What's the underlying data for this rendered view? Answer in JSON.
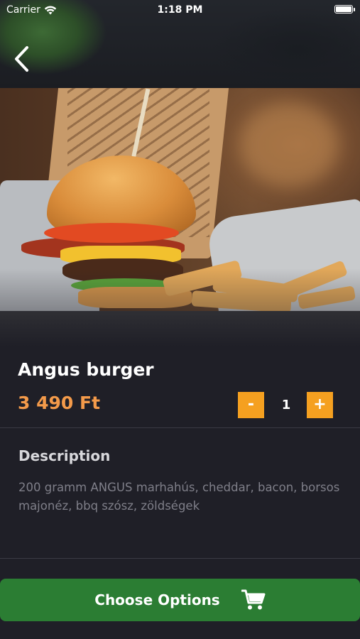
{
  "status_bar": {
    "carrier": "Carrier",
    "time": "1:18 PM",
    "wifi_icon": "wifi-icon",
    "battery_icon": "battery-icon"
  },
  "nav": {
    "back_icon": "chevron-left-icon"
  },
  "hero": {
    "image_subject": "burger-with-fries-photo"
  },
  "product": {
    "name": "Angus burger",
    "price": "3 490 Ft",
    "quantity": "1",
    "minus_label": "-",
    "plus_label": "+"
  },
  "description": {
    "heading": "Description",
    "text": "200 gramm ANGUS marhahús, cheddar, bacon, borsos majonéz, bbq szósz, zöldségek"
  },
  "cta": {
    "label": "Choose Options",
    "icon": "cart-icon"
  },
  "colors": {
    "background": "#1f1f27",
    "accent_orange": "#f5a020",
    "price_orange": "#f39a4a",
    "cta_green": "#2b7d33",
    "muted_text": "#7f7f89"
  }
}
